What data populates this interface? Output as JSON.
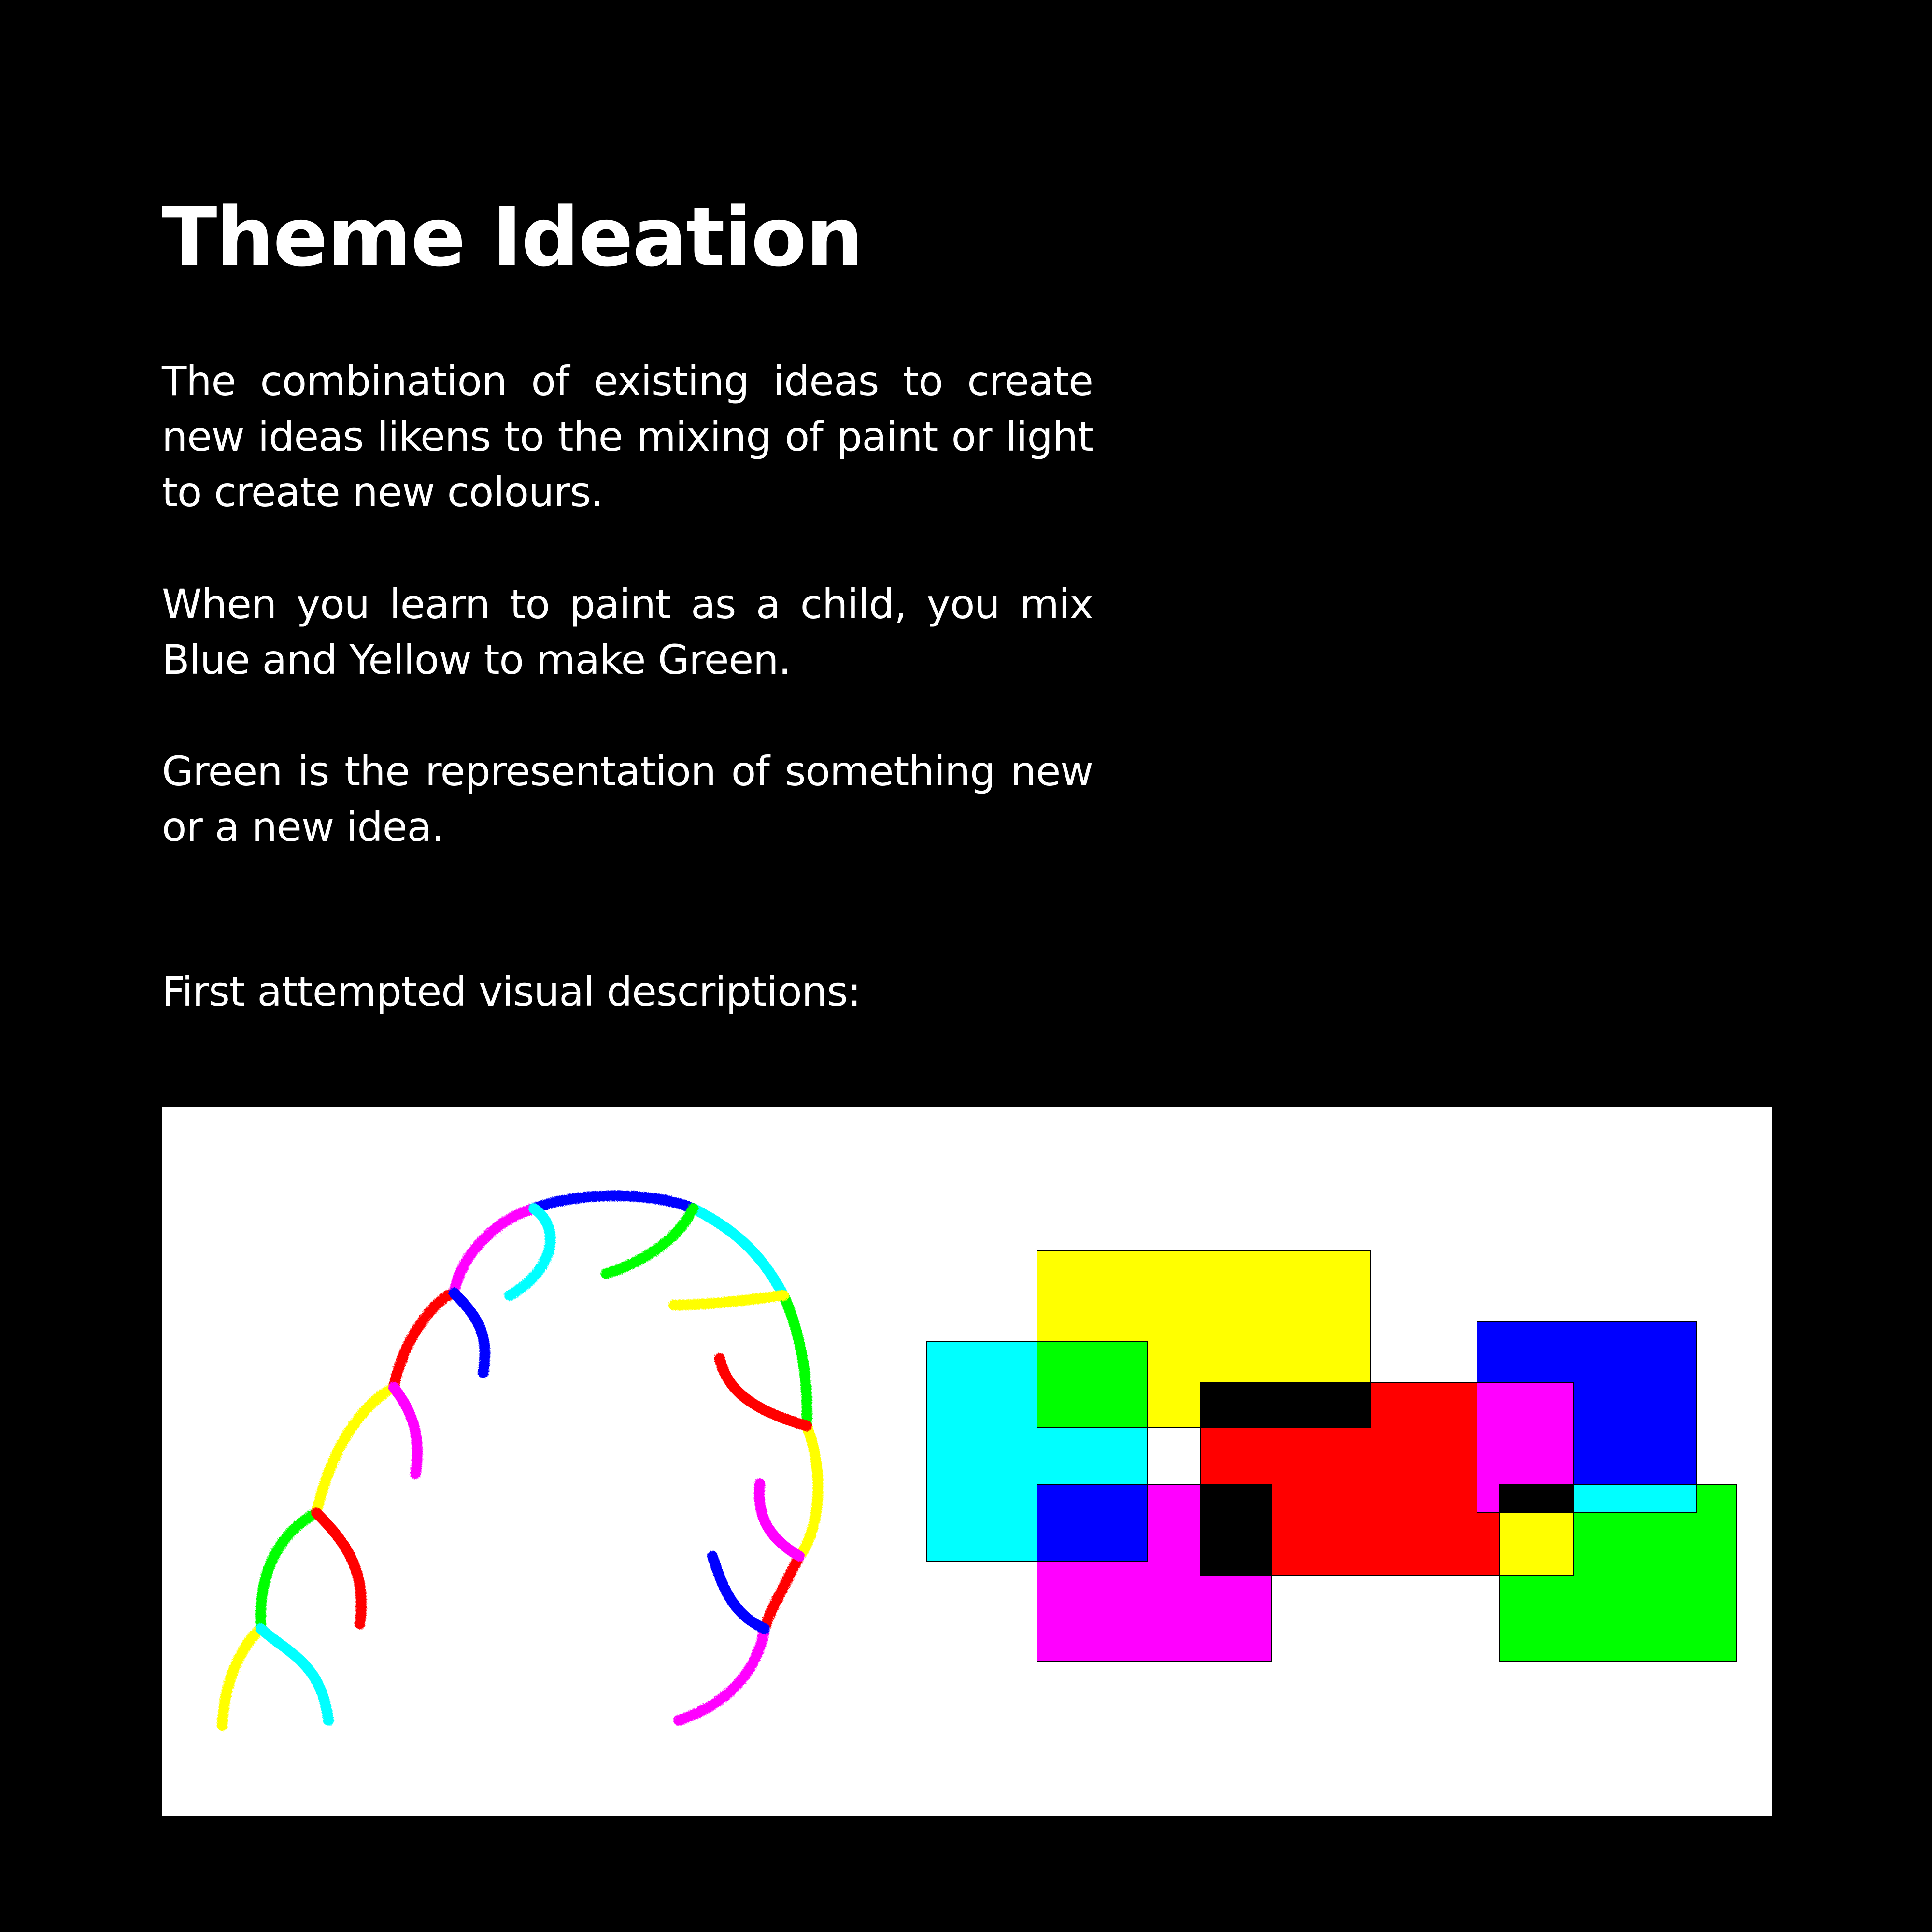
{
  "page": {
    "title": "Theme Ideation",
    "paragraphs": [
      "The combination of existing ideas to create new ideas likens to the mixing of paint or light to create new colours.",
      "When you learn to paint as a child, you mix Blue and Yellow to make Green.",
      "Green is the representation of something new or a new idea."
    ],
    "caption": "First attempted visual descriptions:"
  },
  "illustration": {
    "panel_background": "#ffffff",
    "left_sketch": "hand-drawn multicoloured branching crayon arc",
    "right_sketch": "overlapping colour-mixing rectangles",
    "colors": {
      "red": "#ff0000",
      "green": "#00ff00",
      "blue": "#0000ff",
      "cyan": "#00ffff",
      "magenta": "#ff00ff",
      "yellow": "#ffff00",
      "black": "#000000"
    }
  }
}
